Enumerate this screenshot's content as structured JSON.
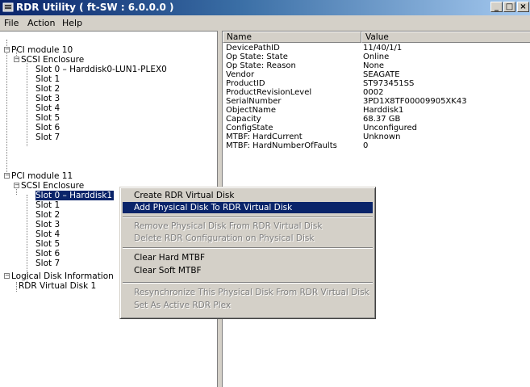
{
  "window": {
    "title": "RDR Utility ( ft-SW : 6.0.0.0 )",
    "min_label": "_",
    "max_label": "□",
    "close_label": "×"
  },
  "menubar": {
    "file": "File",
    "action": "Action",
    "help": "Help"
  },
  "tree": {
    "items": [
      {
        "label": "PCI module 10",
        "expander": "−"
      },
      {
        "label": "SCSI Enclosure",
        "expander": "−"
      },
      {
        "label": "Slot 0  –  Harddisk0-LUN1-PLEX0"
      },
      {
        "label": "Slot 1"
      },
      {
        "label": "Slot 2"
      },
      {
        "label": "Slot 3"
      },
      {
        "label": "Slot 4"
      },
      {
        "label": "Slot 5"
      },
      {
        "label": "Slot 6"
      },
      {
        "label": "Slot 7"
      },
      {
        "label": "PCI module 11",
        "expander": "−"
      },
      {
        "label": "SCSI Enclosure",
        "expander": "−"
      },
      {
        "label": "Slot 0  –  Harddisk1"
      },
      {
        "label": "Slot 1"
      },
      {
        "label": "Slot 2"
      },
      {
        "label": "Slot 3"
      },
      {
        "label": "Slot 4"
      },
      {
        "label": "Slot 5"
      },
      {
        "label": "Slot 6"
      },
      {
        "label": "Slot 7"
      },
      {
        "label": "Logical Disk Information",
        "expander": "−"
      },
      {
        "label": "RDR Virtual Disk 1"
      }
    ]
  },
  "list": {
    "columns": [
      "Name",
      "Value"
    ],
    "rows": [
      {
        "name": "DevicePathID",
        "value": "11/40/1/1"
      },
      {
        "name": "Op State: State",
        "value": "Online"
      },
      {
        "name": "Op State: Reason",
        "value": "None"
      },
      {
        "name": "Vendor",
        "value": "SEAGATE"
      },
      {
        "name": "ProductID",
        "value": "ST973451SS"
      },
      {
        "name": "ProductRevisionLevel",
        "value": "0002"
      },
      {
        "name": "SerialNumber",
        "value": "3PD1X8TF00009905XK43"
      },
      {
        "name": "ObjectName",
        "value": "Harddisk1"
      },
      {
        "name": "Capacity",
        "value": "68.37 GB"
      },
      {
        "name": "ConfigState",
        "value": "Unconfigured"
      },
      {
        "name": "MTBF: HardCurrent",
        "value": "Unknown"
      },
      {
        "name": "MTBF: HardNumberOfFaults",
        "value": "0"
      }
    ]
  },
  "context_menu": {
    "items": [
      {
        "label": "Create RDR Virtual Disk",
        "state": "enabled"
      },
      {
        "label": "Add Physical Disk To RDR Virtual Disk",
        "state": "highlighted"
      },
      {
        "label": "Remove Physical Disk From RDR Virtual Disk",
        "state": "disabled"
      },
      {
        "label": "Delete RDR Configuration on Physical Disk",
        "state": "disabled"
      },
      {
        "label": "Clear Hard MTBF",
        "state": "enabled"
      },
      {
        "label": "Clear Soft MTBF",
        "state": "enabled"
      },
      {
        "label": "Resynchronize This Physical Disk From RDR Virtual Disk",
        "state": "disabled"
      },
      {
        "label": "Set As Active RDR Plex",
        "state": "disabled"
      }
    ]
  },
  "colors": {
    "title_gradient_start": "#0a246a",
    "title_gradient_end": "#a6caf0",
    "selection": "#0a246a",
    "face": "#d4d0c8"
  }
}
